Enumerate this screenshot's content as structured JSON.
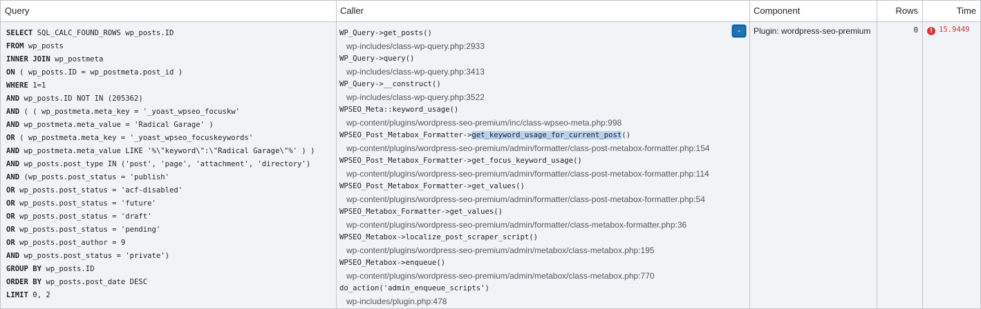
{
  "headers": {
    "query": "Query",
    "caller": "Caller",
    "component": "Component",
    "rows": "Rows",
    "time": "Time"
  },
  "sql_lines": [
    {
      "kw": "SELECT",
      "rest": " SQL_CALC_FOUND_ROWS wp_posts.ID"
    },
    {
      "kw": "FROM",
      "rest": " wp_posts"
    },
    {
      "kw": "INNER JOIN",
      "rest": " wp_postmeta"
    },
    {
      "kw": "ON",
      "rest": " ( wp_posts.ID = wp_postmeta.post_id )"
    },
    {
      "kw": "WHERE",
      "rest": " 1=1"
    },
    {
      "kw": "AND",
      "rest": " wp_posts.ID NOT IN (205362)"
    },
    {
      "kw": "AND",
      "rest": " ( ( wp_postmeta.meta_key = '_yoast_wpseo_focuskw'"
    },
    {
      "kw": "AND",
      "rest": " wp_postmeta.meta_value = 'Radical Garage' )"
    },
    {
      "kw": "OR",
      "rest": " ( wp_postmeta.meta_key = '_yoast_wpseo_focuskeywords'"
    },
    {
      "kw": "AND",
      "rest": " wp_postmeta.meta_value LIKE '%\\\"keyword\\\":\\\"Radical Garage\\\"%' ) )"
    },
    {
      "kw": "AND",
      "rest": " wp_posts.post_type IN ('post', 'page', 'attachment', 'directory')"
    },
    {
      "kw": "AND",
      "rest": " (wp_posts.post_status = 'publish'"
    },
    {
      "kw": "OR",
      "rest": " wp_posts.post_status = 'acf-disabled'"
    },
    {
      "kw": "OR",
      "rest": " wp_posts.post_status = 'future'"
    },
    {
      "kw": "OR",
      "rest": " wp_posts.post_status = 'draft'"
    },
    {
      "kw": "OR",
      "rest": " wp_posts.post_status = 'pending'"
    },
    {
      "kw": "OR",
      "rest": " wp_posts.post_author = 9"
    },
    {
      "kw": "AND",
      "rest": " wp_posts.post_status = 'private')"
    },
    {
      "kw": "GROUP BY",
      "rest": " wp_posts.ID"
    },
    {
      "kw": "ORDER BY",
      "rest": " wp_posts.post_date DESC"
    },
    {
      "kw": "LIMIT",
      "rest": " 0, 2"
    }
  ],
  "caller_frames": [
    {
      "pre": "WP_Query->get_posts()",
      "hl": "",
      "post": "",
      "file": "wp-includes/class-wp-query.php:2933"
    },
    {
      "pre": "WP_Query->query()",
      "hl": "",
      "post": "",
      "file": "wp-includes/class-wp-query.php:3413"
    },
    {
      "pre": "WP_Query->__construct()",
      "hl": "",
      "post": "",
      "file": "wp-includes/class-wp-query.php:3522"
    },
    {
      "pre": "WPSEO_Meta::keyword_usage()",
      "hl": "",
      "post": "",
      "file": "wp-content/plugins/wordpress-seo-premium/inc/class-wpseo-meta.php:998"
    },
    {
      "pre": "WPSEO_Post_Metabox_Formatter->",
      "hl": "get_keyword_usage_for_current_post",
      "post": "()",
      "file": "wp-content/plugins/wordpress-seo-premium/admin/formatter/class-post-metabox-formatter.php:154"
    },
    {
      "pre": "WPSEO_Post_Metabox_Formatter->get_focus_keyword_usage()",
      "hl": "",
      "post": "",
      "file": "wp-content/plugins/wordpress-seo-premium/admin/formatter/class-post-metabox-formatter.php:114"
    },
    {
      "pre": "WPSEO_Post_Metabox_Formatter->get_values()",
      "hl": "",
      "post": "",
      "file": "wp-content/plugins/wordpress-seo-premium/admin/formatter/class-post-metabox-formatter.php:54"
    },
    {
      "pre": "WPSEO_Metabox_Formatter->get_values()",
      "hl": "",
      "post": "",
      "file": "wp-content/plugins/wordpress-seo-premium/admin/formatter/class-metabox-formatter.php:36"
    },
    {
      "pre": "WPSEO_Metabox->localize_post_scraper_script()",
      "hl": "",
      "post": "",
      "file": "wp-content/plugins/wordpress-seo-premium/admin/metabox/class-metabox.php:195"
    },
    {
      "pre": "WPSEO_Metabox->enqueue()",
      "hl": "",
      "post": "",
      "file": "wp-content/plugins/wordpress-seo-premium/admin/metabox/class-metabox.php:770"
    },
    {
      "pre": "do_action('admin_enqueue_scripts')",
      "hl": "",
      "post": "",
      "file": "wp-includes/plugin.php:478"
    }
  ],
  "toggle_label": "-",
  "component": "Plugin: wordpress-seo-premium",
  "rows": "0",
  "time": "15.9449",
  "warning_glyph": "!",
  "icons": {
    "warning": "warning-icon",
    "toggle": "collapse-toggle"
  },
  "colors": {
    "accent": "#2271b1",
    "error": "#d63638",
    "row_bg": "#f1f4f7",
    "highlight": "#b9d1ee"
  }
}
